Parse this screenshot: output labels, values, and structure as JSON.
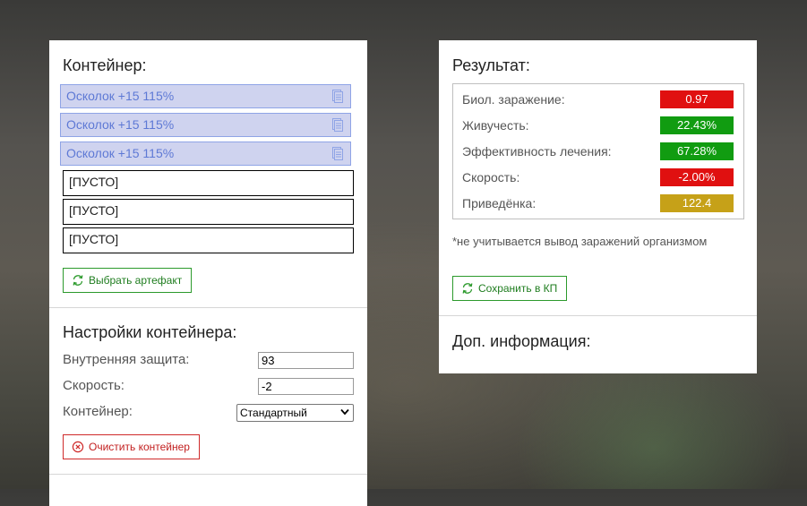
{
  "container": {
    "title": "Контейнер:",
    "slots": [
      {
        "label": "Осколок +15 115%",
        "filled": true
      },
      {
        "label": "Осколок +15 115%",
        "filled": true
      },
      {
        "label": "Осколок +15 115%",
        "filled": true
      },
      {
        "label": "[ПУСТО]",
        "filled": false
      },
      {
        "label": "[ПУСТО]",
        "filled": false
      },
      {
        "label": "[ПУСТО]",
        "filled": false
      }
    ],
    "choose_button": "Выбрать артефакт"
  },
  "settings": {
    "title": "Настройки контейнера:",
    "inner_protection_label": "Внутренняя защита:",
    "inner_protection_value": "93",
    "speed_label": "Скорость:",
    "speed_value": "-2",
    "container_label": "Контейнер:",
    "container_selected": "Стандартный",
    "clear_button": "Очистить контейнер"
  },
  "result": {
    "title": "Результат:",
    "stats": [
      {
        "label": "Биол. заражение:",
        "value": "0.97",
        "color": "#e01010"
      },
      {
        "label": "Живучесть:",
        "value": "22.43%",
        "color": "#119c11"
      },
      {
        "label": "Эффективность лечения:",
        "value": "67.28%",
        "color": "#119c11"
      },
      {
        "label": "Скорость:",
        "value": "-2.00%",
        "color": "#e01010"
      },
      {
        "label": "Приведёнка:",
        "value": "122.4",
        "color": "#c6a118"
      }
    ],
    "note": "*не учитывается вывод заражений организмом",
    "save_button": "Сохранить в КП",
    "extra_title": "Доп. информация:"
  },
  "colors": {
    "filled_slot_bg": "#cfd3ef",
    "filled_slot_text": "#5e79d5",
    "green_button": "#2c9a2c",
    "red_button": "#cf2a2a"
  },
  "icons": {
    "slot": "document-icon",
    "choose_button": "refresh-icon",
    "save_button": "refresh-icon",
    "clear_button": "close-circle-icon",
    "select": "chevron-down-icon"
  }
}
